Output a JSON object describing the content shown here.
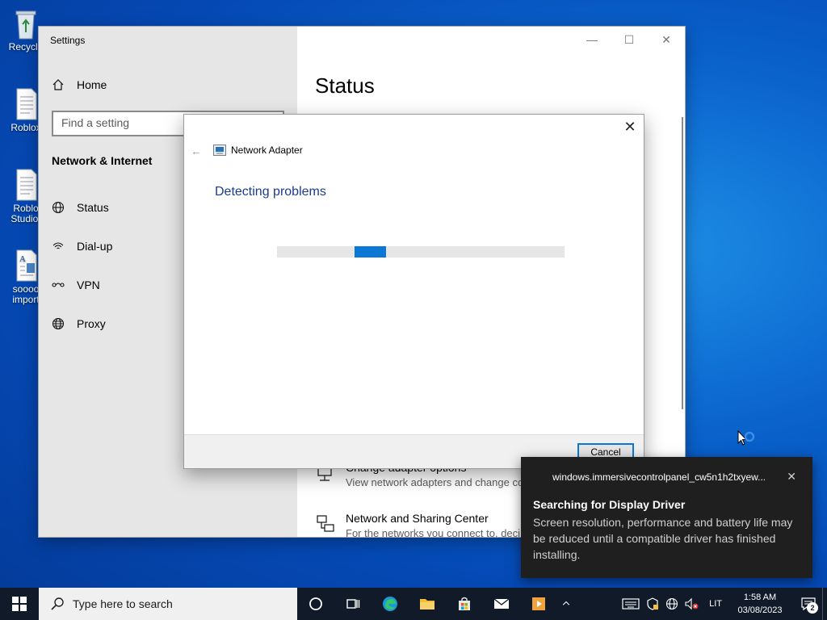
{
  "desktop": {
    "icons": [
      {
        "label": "Recycle",
        "icon": "recycle-bin-icon"
      },
      {
        "label": "Roblox",
        "icon": "document-icon"
      },
      {
        "label": "Roblo Studio.",
        "icon": "document-icon"
      },
      {
        "label": "soooo import",
        "icon": "wordpad-document-icon"
      }
    ]
  },
  "settings": {
    "window_title": "Settings",
    "controls": {
      "minimize": "—",
      "maximize": "☐",
      "close": "✕"
    },
    "nav": {
      "home_label": "Home",
      "search_placeholder": "Find a setting",
      "section_title": "Network & Internet",
      "items": [
        {
          "label": "Status",
          "icon": "globe-status-icon"
        },
        {
          "label": "Dial-up",
          "icon": "dial-up-icon"
        },
        {
          "label": "VPN",
          "icon": "vpn-icon"
        },
        {
          "label": "Proxy",
          "icon": "globe-icon"
        }
      ]
    },
    "main": {
      "title": "Status",
      "items": [
        {
          "title": "Change adapter options",
          "subtitle": "View network adapters and change co",
          "icon": "adapter-icon"
        },
        {
          "title": "Network and Sharing Center",
          "subtitle": "For the networks you connect to, deci",
          "icon": "sharing-center-icon"
        }
      ]
    }
  },
  "dialog": {
    "close": "✕",
    "back": "←",
    "header": "Network Adapter",
    "status_text": "Detecting problems",
    "progress": {
      "start": 0.27,
      "width": 0.11
    },
    "cancel_label": "Cancel"
  },
  "toast": {
    "app": "windows.immersivecontrolpanel_cw5n1h2txyew...",
    "close": "✕",
    "title": "Searching for Display Driver",
    "body": "Screen resolution, performance and battery life may be reduced until a compatible driver has finished installing."
  },
  "taskbar": {
    "search_placeholder": "Type here to search",
    "language": "LIT",
    "time": "1:58 AM",
    "date": "03/08/2023",
    "notification_count": "2",
    "colors": {
      "accent": "#0a78d4",
      "taskbar_bg": "#101a28"
    }
  }
}
